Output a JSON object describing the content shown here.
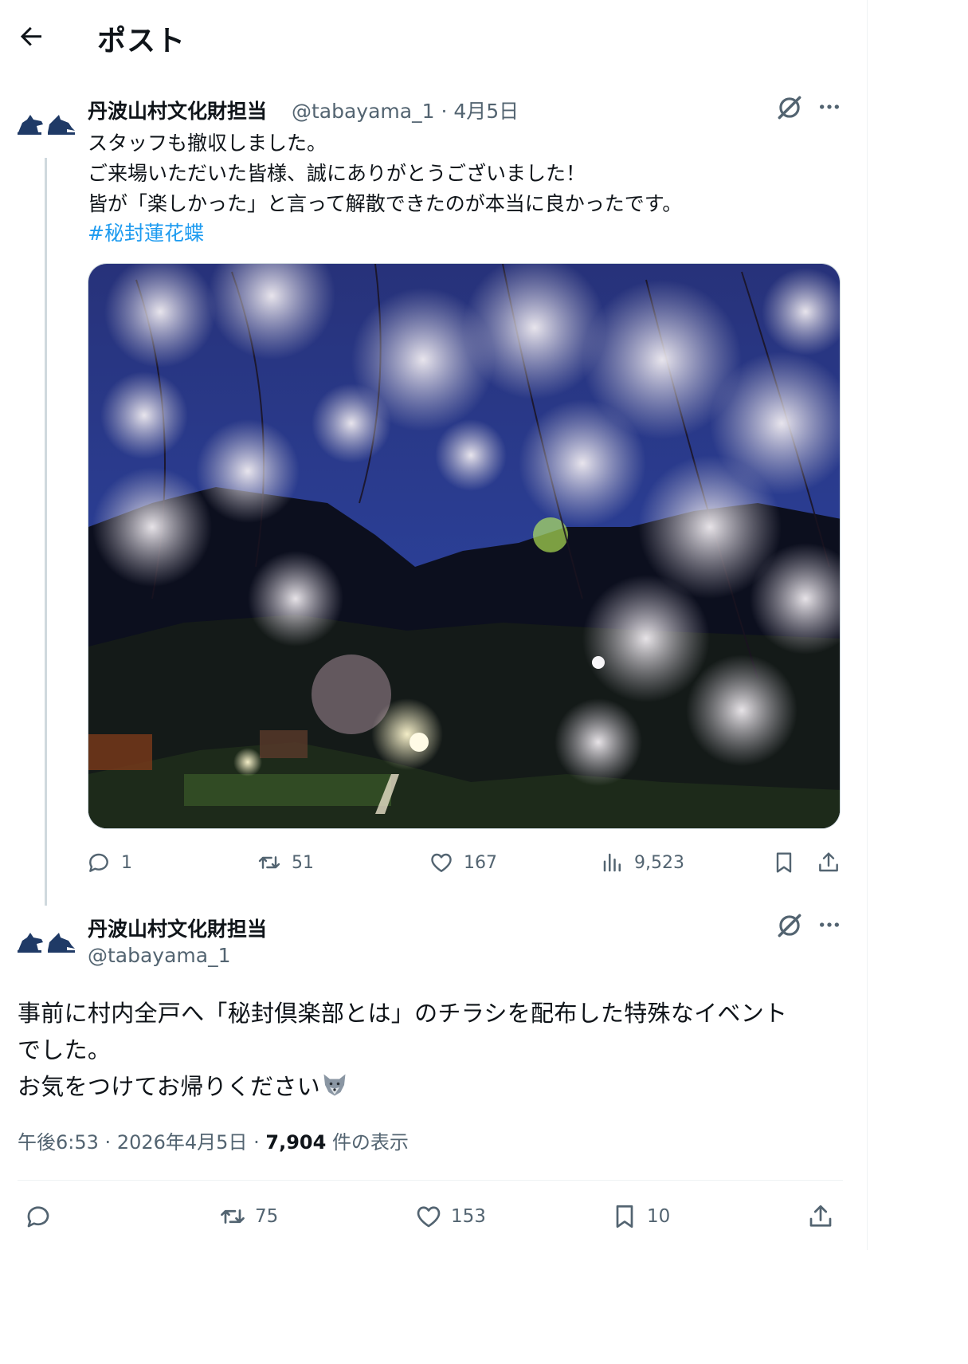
{
  "header": {
    "title": "ポスト",
    "back_icon": "arrow-left-icon"
  },
  "reply_post": {
    "display_name": "丹波山村文化財担当",
    "handle": "@tabayama_1",
    "separator": "·",
    "date": "4月5日",
    "text_lines": [
      "スタッフも撤収しました。",
      "ご来場いただいた皆様、誠にありがとうございました！",
      "皆が「楽しかった」と言って解散できたのが本当に良かったです。"
    ],
    "hashtag": "#秘封蓮花蝶",
    "image_description": "night-cherry-blossoms-photo",
    "actions": {
      "replies": "1",
      "reposts": "51",
      "likes": "167",
      "views": "9,523"
    }
  },
  "main_post": {
    "display_name": "丹波山村文化財担当",
    "handle": "@tabayama_1",
    "text_lines": [
      "事前に村内全戸へ「秘封倶楽部とは」のチラシを配布した特殊なイベント",
      "でした。",
      "お気をつけてお帰りください"
    ],
    "emoji": "wolf-emoji",
    "time": "午後6:53",
    "separator": "·",
    "date": "2026年4月5日",
    "views_count": "7,904",
    "views_label": "件の表示",
    "actions": {
      "replies": "",
      "reposts": "75",
      "likes": "153",
      "bookmarks": "10"
    }
  },
  "colors": {
    "text": "#0f1419",
    "secondary": "#536471",
    "link": "#1d9bf0",
    "border": "#eff3f4",
    "avatar": "#1f3a66"
  }
}
